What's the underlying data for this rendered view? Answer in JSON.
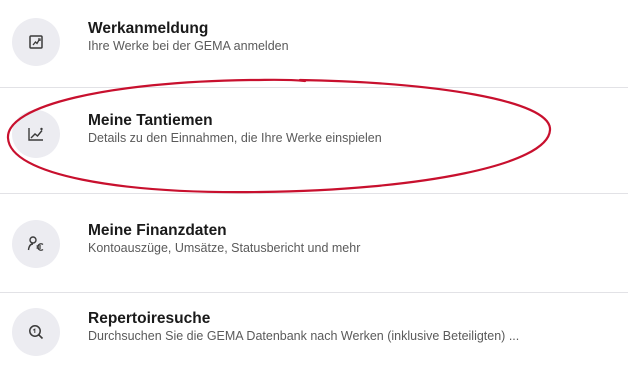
{
  "menu": {
    "items": [
      {
        "title": "Werkanmeldung",
        "subtitle": "Ihre Werke bei der GEMA anmelden",
        "icon": "document-register-icon"
      },
      {
        "title": "Meine Tantiemen",
        "subtitle": "Details zu den Einnahmen, die Ihre Werke einspielen",
        "icon": "chart-trend-icon"
      },
      {
        "title": "Meine Finanzdaten",
        "subtitle": "Kontoauszüge, Umsätze, Statusbericht und mehr",
        "icon": "person-euro-icon"
      },
      {
        "title": "Repertoiresuche",
        "subtitle": "Durchsuchen Sie die GEMA Datenbank nach Werken (inklusive Beteiligten) ...",
        "icon": "search-icon"
      }
    ]
  },
  "colors": {
    "icon_background": "#ececf1",
    "title": "#1a1a1a",
    "subtitle": "#5a5a5a",
    "divider": "#e2e2e6",
    "annotation": "#c8102e"
  }
}
